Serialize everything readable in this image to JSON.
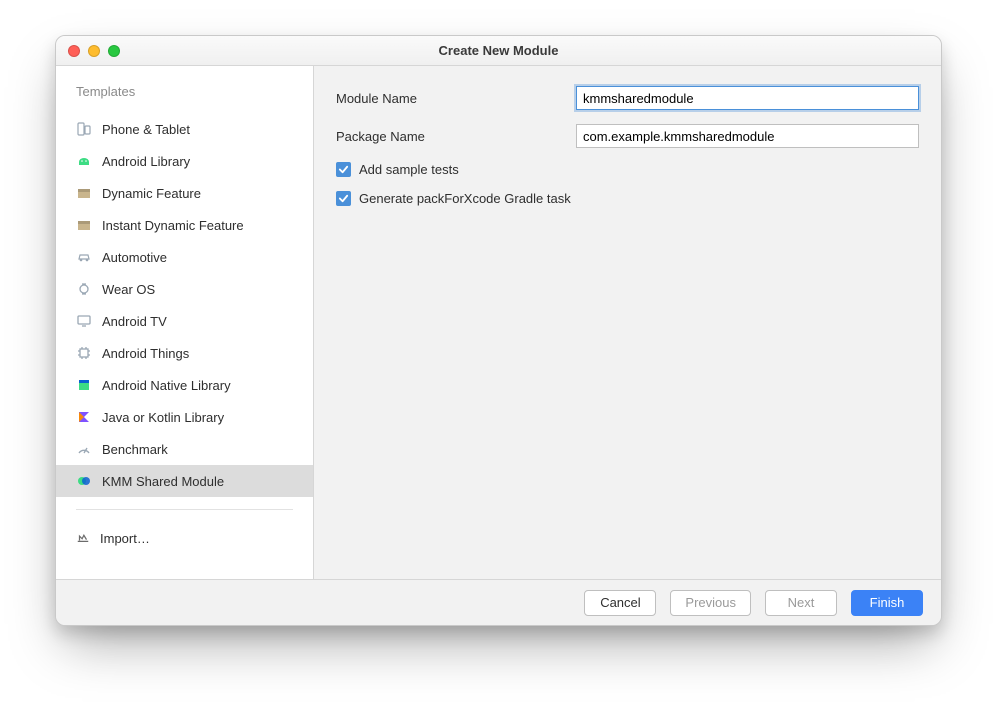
{
  "dialog": {
    "title": "Create New Module"
  },
  "sidebar": {
    "header": "Templates",
    "items": [
      {
        "label": "Phone & Tablet",
        "icon": "phone-tablet-icon",
        "color": "#9aa7b4",
        "selected": false
      },
      {
        "label": "Android Library",
        "icon": "android-icon",
        "color": "#3ddc84",
        "selected": false
      },
      {
        "label": "Dynamic Feature",
        "icon": "box-icon",
        "color": "#c9b58d",
        "selected": false
      },
      {
        "label": "Instant Dynamic Feature",
        "icon": "box-icon",
        "color": "#c9b58d",
        "selected": false
      },
      {
        "label": "Automotive",
        "icon": "car-icon",
        "color": "#9aa7b4",
        "selected": false
      },
      {
        "label": "Wear OS",
        "icon": "watch-icon",
        "color": "#9aa7b4",
        "selected": false
      },
      {
        "label": "Android TV",
        "icon": "tv-icon",
        "color": "#9aa7b4",
        "selected": false
      },
      {
        "label": "Android Things",
        "icon": "chip-icon",
        "color": "#9aa7b4",
        "selected": false
      },
      {
        "label": "Android Native Library",
        "icon": "native-icon",
        "color": "#3a86ff",
        "selected": false
      },
      {
        "label": "Java or Kotlin Library",
        "icon": "kotlin-icon",
        "color": "#7f52ff",
        "selected": false
      },
      {
        "label": "Benchmark",
        "icon": "gauge-icon",
        "color": "#9aa7b4",
        "selected": false
      },
      {
        "label": "KMM Shared Module",
        "icon": "kmm-icon",
        "color": "#3ddc84",
        "selected": true
      }
    ],
    "import_label": "Import…"
  },
  "form": {
    "module_name_label": "Module Name",
    "module_name_value": "kmmsharedmodule",
    "package_name_label": "Package Name",
    "package_name_value": "com.example.kmmsharedmodule",
    "add_sample_tests_label": "Add sample tests",
    "add_sample_tests_checked": true,
    "gen_pack_label": "Generate packForXcode Gradle task",
    "gen_pack_checked": true
  },
  "footer": {
    "cancel": "Cancel",
    "previous": "Previous",
    "next": "Next",
    "finish": "Finish"
  }
}
